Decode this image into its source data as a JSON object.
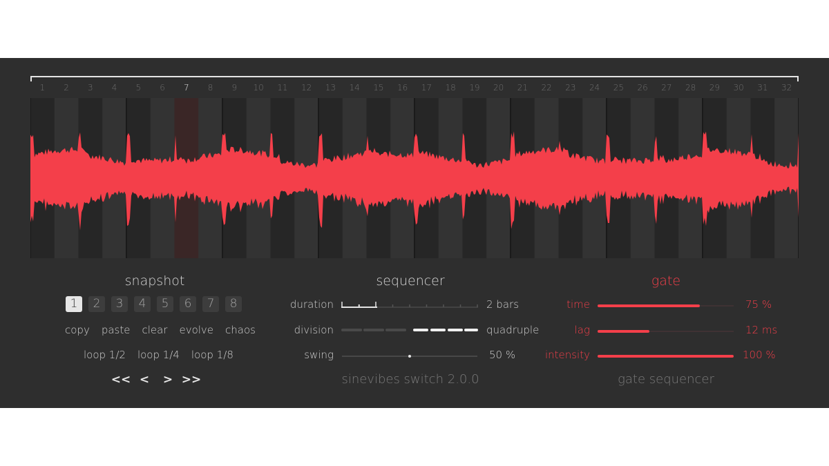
{
  "steps": {
    "count": 32,
    "labels": [
      "1",
      "2",
      "3",
      "4",
      "5",
      "6",
      "7",
      "8",
      "9",
      "10",
      "11",
      "12",
      "13",
      "14",
      "15",
      "16",
      "17",
      "18",
      "19",
      "20",
      "21",
      "22",
      "23",
      "24",
      "25",
      "26",
      "27",
      "28",
      "29",
      "30",
      "31",
      "32"
    ],
    "active_step": 7
  },
  "colors": {
    "panel": "#2e2e2e",
    "accent": "#f43f4a",
    "text": "#cfcfcf",
    "dim_text": "#7a7a7a"
  },
  "snapshot": {
    "title": "snapshot",
    "slots": [
      "1",
      "2",
      "3",
      "4",
      "5",
      "6",
      "7",
      "8"
    ],
    "active_slot": 1,
    "actions": [
      "copy",
      "paste",
      "clear",
      "evolve",
      "chaos"
    ],
    "loops": [
      "loop 1/2",
      "loop 1/4",
      "loop 1/8"
    ],
    "nav": [
      {
        "label": "<<",
        "icon": "double-chevron-left-icon"
      },
      {
        "label": "<",
        "icon": "chevron-left-icon"
      },
      {
        "label": ">",
        "icon": "chevron-right-icon"
      },
      {
        "label": ">>",
        "icon": "double-chevron-right-icon"
      }
    ]
  },
  "sequencer": {
    "title": "sequencer",
    "duration": {
      "label": "duration",
      "value": "2 bars"
    },
    "division": {
      "label": "division",
      "value": "quadruple"
    },
    "swing": {
      "label": "swing",
      "value": "50 %",
      "fraction": 0.5
    }
  },
  "gate": {
    "title": "gate",
    "time": {
      "label": "time",
      "value": "75 %",
      "fraction": 0.75
    },
    "lag": {
      "label": "lag",
      "value": "12 ms",
      "fraction": 0.38
    },
    "intensity": {
      "label": "intensity",
      "value": "100 %",
      "fraction": 1.0
    }
  },
  "footer": {
    "product": "sinevibes switch 2.0.0",
    "mode": "gate sequencer"
  }
}
